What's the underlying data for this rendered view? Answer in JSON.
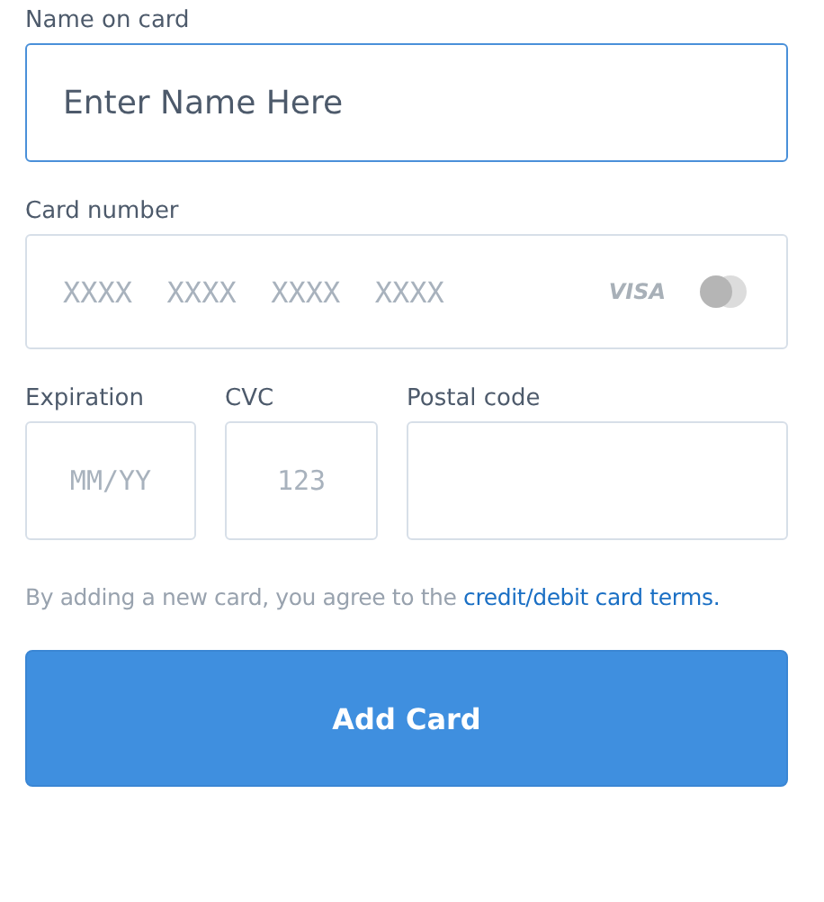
{
  "name_field": {
    "label": "Name on card",
    "value": "Enter Name Here",
    "focused": true
  },
  "card_field": {
    "label": "Card number",
    "placeholder": "XXXX  XXXX  XXXX  XXXX",
    "brand": "VISA"
  },
  "small_fields": [
    {
      "label": "Expiration",
      "placeholder": "MM/YY"
    },
    {
      "label": "CVC",
      "placeholder": "123"
    },
    {
      "label": "Postal code"
    }
  ],
  "terms": {
    "text": "By adding a new card, you agree to the",
    "link": "credit/debit card terms."
  },
  "submit": {
    "label": "Add Card"
  }
}
